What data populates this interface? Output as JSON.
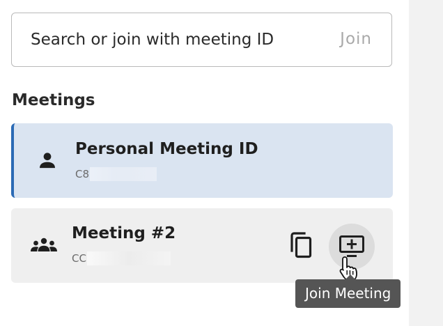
{
  "search": {
    "placeholder": "Search or join with meeting ID",
    "value": "",
    "join_label": "Join"
  },
  "meetings_heading": "Meetings",
  "meetings": [
    {
      "title": "Personal Meeting ID",
      "id_prefix": "C8",
      "id_redacted": true,
      "icon": "person-icon",
      "selected": true
    },
    {
      "title": "Meeting #2",
      "id_prefix": "CC",
      "id_redacted": true,
      "icon": "group-icon",
      "selected": false,
      "actions": [
        {
          "name": "copy-icon"
        },
        {
          "name": "join-meeting-icon"
        }
      ]
    }
  ],
  "tooltip": {
    "label": "Join Meeting"
  },
  "colors": {
    "selected_background": "#dae4f1",
    "selected_accent": "#2b6ab5",
    "card_background": "#efefef",
    "tooltip_background": "#555555",
    "right_panel": "#f2f2f2"
  }
}
